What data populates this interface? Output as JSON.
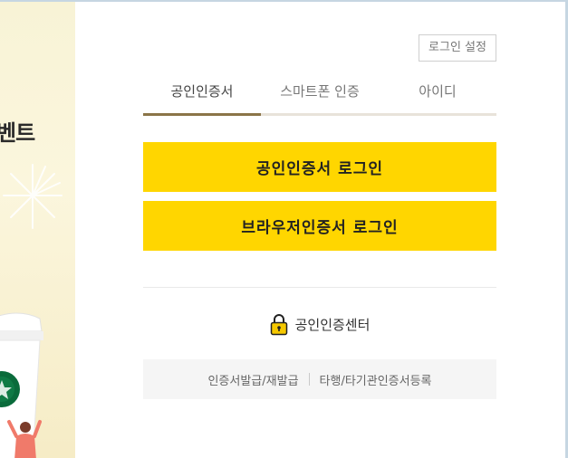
{
  "promo": {
    "title_fragment": "벤트"
  },
  "settings": {
    "label": "로그인 설정"
  },
  "tabs": [
    {
      "label": "공인인증서",
      "active": true
    },
    {
      "label": "스마트폰 인증",
      "active": false
    },
    {
      "label": "아이디",
      "active": false
    }
  ],
  "buttons": {
    "cert_login": "공인인증서 로그인",
    "browser_cert_login": "브라우저인증서 로그인"
  },
  "center": {
    "icon": "lock-icon",
    "label": "공인인증센터"
  },
  "links": [
    {
      "label": "인증서발급/재발급"
    },
    {
      "label": "타행/타기관인증서등록"
    }
  ],
  "colors": {
    "accent_yellow": "#ffd600",
    "tab_active_underline": "#8b7548",
    "lock_yellow": "#f5c800"
  }
}
